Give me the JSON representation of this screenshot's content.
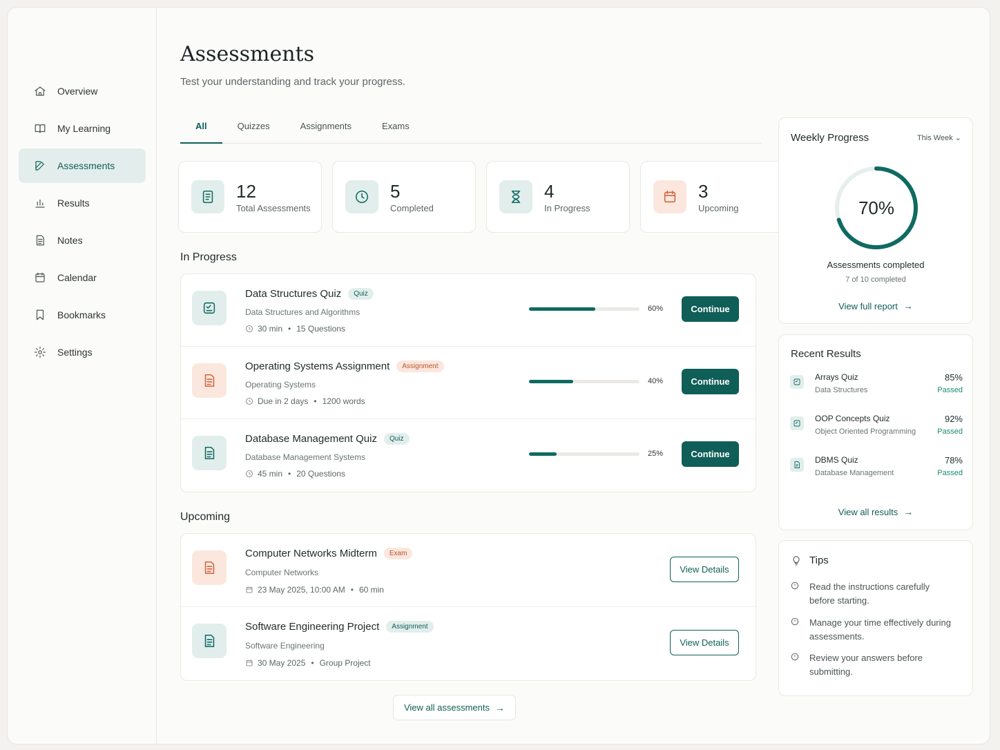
{
  "sidebar": {
    "items": [
      {
        "label": "Overview",
        "icon": "home-icon"
      },
      {
        "label": "My Learning",
        "icon": "book-icon"
      },
      {
        "label": "Assessments",
        "icon": "edit-icon",
        "active": true
      },
      {
        "label": "Results",
        "icon": "bar-chart-icon"
      },
      {
        "label": "Notes",
        "icon": "notes-icon"
      },
      {
        "label": "Calendar",
        "icon": "calendar-icon"
      },
      {
        "label": "Bookmarks",
        "icon": "bookmark-icon"
      },
      {
        "label": "Settings",
        "icon": "gear-icon"
      }
    ]
  },
  "header": {
    "title": "Assessments",
    "subtitle": "Test your understanding and track your progress."
  },
  "tabs": [
    "All",
    "Quizzes",
    "Assignments",
    "Exams"
  ],
  "stats": [
    {
      "value": "12",
      "label": "Total Assessments",
      "icon": "document-icon"
    },
    {
      "value": "5",
      "label": "Completed",
      "icon": "clock-icon"
    },
    {
      "value": "4",
      "label": "In Progress",
      "icon": "hourglass-icon"
    },
    {
      "value": "3",
      "label": "Upcoming",
      "icon": "calendar-icon"
    }
  ],
  "in_progress": {
    "title": "In Progress",
    "items": [
      {
        "title": "Data Structures Quiz",
        "badge": "Quiz",
        "subject": "Data Structures and Algorithms",
        "meta1": "30 min",
        "meta2": "15 Questions",
        "progress": 60,
        "progress_label": "60%",
        "action": "Continue"
      },
      {
        "title": "Operating Systems Assignment",
        "badge": "Assignment",
        "subject": "Operating Systems",
        "meta1": "Due in 2 days",
        "meta2": "1200 words",
        "progress": 40,
        "progress_label": "40%",
        "action": "Continue"
      },
      {
        "title": "Database Management Quiz",
        "badge": "Quiz",
        "subject": "Database Management Systems",
        "meta1": "45 min",
        "meta2": "20 Questions",
        "progress": 25,
        "progress_label": "25%",
        "action": "Continue"
      }
    ]
  },
  "upcoming": {
    "title": "Upcoming",
    "items": [
      {
        "title": "Computer Networks Midterm",
        "badge": "Exam",
        "subject": "Computer Networks",
        "meta1": "23 May 2025, 10:00 AM",
        "meta2": "60 min",
        "action": "View Details"
      },
      {
        "title": "Software Engineering Project",
        "badge": "Assignment",
        "subject": "Software Engineering",
        "meta1": "30 May 2025",
        "meta2": "Group Project",
        "action": "View Details"
      }
    ]
  },
  "view_all_assessments": "View all assessments",
  "weekly": {
    "title": "Weekly Progress",
    "period": "This Week",
    "percent": 70,
    "percent_label": "70%",
    "caption": "Assessments completed",
    "detail": "7 of 10 completed",
    "link": "View full report"
  },
  "recent": {
    "title": "Recent Results",
    "items": [
      {
        "title": "Arrays Quiz",
        "subject": "Data Structures",
        "score": "85%",
        "status": "Passed"
      },
      {
        "title": "OOP Concepts Quiz",
        "subject": "Object Oriented Programming",
        "score": "92%",
        "status": "Passed"
      },
      {
        "title": "DBMS Quiz",
        "subject": "Database Management",
        "score": "78%",
        "status": "Passed"
      }
    ],
    "link": "View all results"
  },
  "tips": {
    "title": "Tips",
    "items": [
      "Read the instructions carefully before starting.",
      "Manage your time effectively during assessments.",
      "Review your answers before submitting."
    ]
  },
  "colors": {
    "accent": "#0f5e57",
    "orange": "#d0663f",
    "passed": "#1a8a70"
  }
}
